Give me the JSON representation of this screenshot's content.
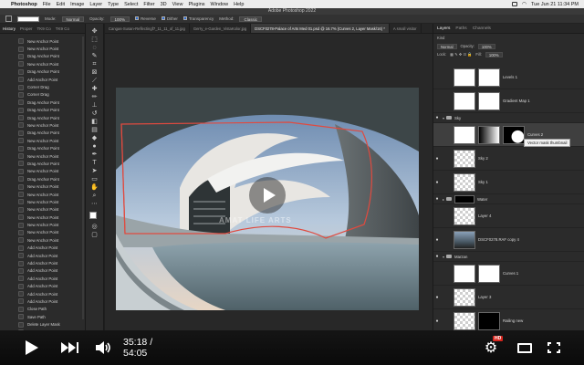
{
  "menubar": {
    "app": "Photoshop",
    "items": [
      "File",
      "Edit",
      "Image",
      "Layer",
      "Type",
      "Select",
      "Filter",
      "3D",
      "View",
      "Plugins",
      "Window",
      "Help"
    ],
    "clock": "Tue Jun 21 11:34 PM"
  },
  "window": {
    "title": "Adobe Photoshop 2022"
  },
  "options": {
    "mode_label": "Mode:",
    "mode_value": "Normal",
    "opacity_label": "Opacity:",
    "opacity_value": "100%",
    "reverse": "Reverse",
    "dither": "Dither",
    "transparency": "Transparency",
    "method_label": "Method:",
    "method_value": "Classic"
  },
  "history": {
    "tabs": [
      "History",
      "Proper",
      "TK9 Co",
      "TK9 Co"
    ],
    "items": [
      "New Anchor Point",
      "New Anchor Point",
      "Drag Anchor Point",
      "New Anchor Point",
      "Drag Anchor Point",
      "Add Anchor Point",
      "Corner Drag",
      "Corner Drag",
      "Drag Anchor Point",
      "Drag Anchor Point",
      "Drag Anchor Point",
      "New Anchor Point",
      "Drag Anchor Point",
      "New Anchor Point",
      "Drag Anchor Point",
      "New Anchor Point",
      "Drag Anchor Point",
      "New Anchor Point",
      "Drag Anchor Point",
      "New Anchor Point",
      "New Anchor Point",
      "New Anchor Point",
      "New Anchor Point",
      "New Anchor Point",
      "New Anchor Point",
      "New Anchor Point",
      "New Anchor Point",
      "Add Anchor Point",
      "Add Anchor Point",
      "Add Anchor Point",
      "Add Anchor Point",
      "Add Anchor Point",
      "Add Anchor Point",
      "Add Anchor Point",
      "Add Anchor Point",
      "Close Path",
      "Save Path",
      "Delete Layer Mask",
      "Add Layer Mask",
      "Add Anchor Point",
      "Invert"
    ]
  },
  "doctabs": [
    "Cangas-Susan-Reflectingf7_11_11_of_11.jpg",
    "Gerry_e-Garden_VistaKolor.jpg",
    "DSCF0278-Palace of Arts Med 01.psd @ 16.7% (Curves 2, Layer Mask/16) *",
    "A small visitor"
  ],
  "canvas": {
    "watermark": "AMAT LIFE ARTS"
  },
  "layers": {
    "tabs": [
      "Layers",
      "Paths",
      "Channels"
    ],
    "kind_label": "Kind",
    "blend_value": "Normal",
    "opacity_label": "Opacity:",
    "opacity_value": "100%",
    "lock_label": "Lock:",
    "fill_label": "Fill:",
    "fill_value": "100%",
    "rows": [
      {
        "name": "Levels 1"
      },
      {
        "name": "Gradient Map 1"
      },
      {
        "name": "Sky"
      },
      {
        "name": "Curves 2"
      },
      {
        "name": "Sky 2"
      },
      {
        "name": "Sky 1"
      },
      {
        "name": "Water"
      },
      {
        "name": "Layer 4"
      },
      {
        "name": "DSCF0278.RAF copy 4"
      },
      {
        "name": "Marzan"
      },
      {
        "name": "Curves 1"
      },
      {
        "name": "Layer 3"
      },
      {
        "name": "Railing new"
      }
    ],
    "tooltip": "Vector mask thumbnail"
  },
  "player": {
    "time": "35:18 / 54:05",
    "hd_badge": "HD"
  }
}
